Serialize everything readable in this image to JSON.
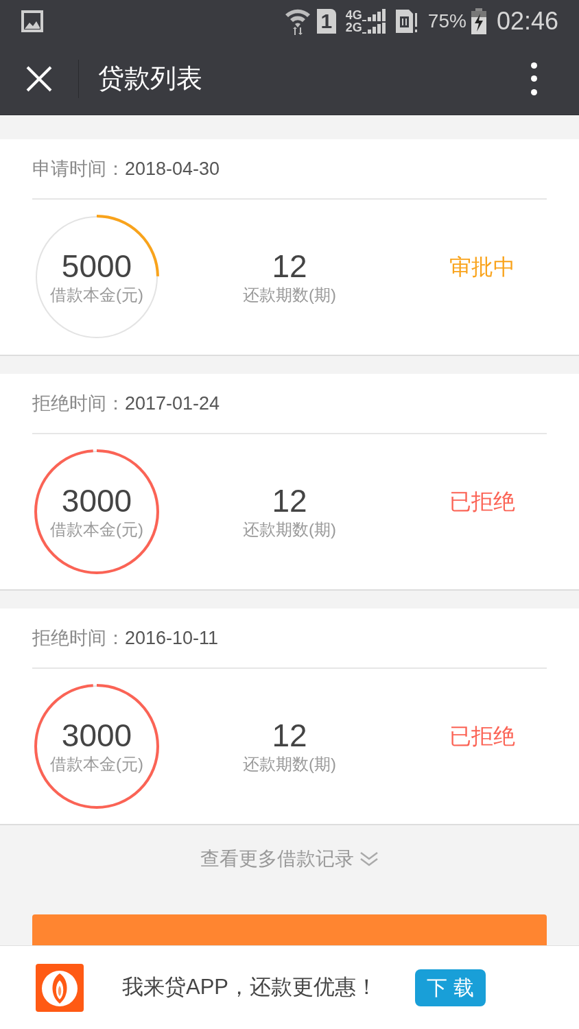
{
  "status_bar": {
    "sim_slot": "1",
    "network_labels": [
      "4G",
      "2G"
    ],
    "battery": "75%",
    "time": "02:46"
  },
  "nav_bar": {
    "title": "贷款列表"
  },
  "loans": [
    {
      "date_label": "申请时间：",
      "date": "2018-04-30",
      "amount": "5000",
      "amount_label": "借款本金(元)",
      "periods": "12",
      "periods_label": "还款期数(期)",
      "status": "审批中",
      "kind": "pending",
      "level": 0.25
    },
    {
      "date_label": "拒绝时间：",
      "date": "2017-01-24",
      "amount": "3000",
      "amount_label": "借款本金(元)",
      "periods": "12",
      "periods_label": "还款期数(期)",
      "status": "已拒绝",
      "kind": "rejected",
      "level": 1
    },
    {
      "date_label": "拒绝时间：",
      "date": "2016-10-11",
      "amount": "3000",
      "amount_label": "借款本金(元)",
      "periods": "12",
      "periods_label": "还款期数(期)",
      "status": "已拒绝",
      "kind": "rejected",
      "level": 1
    }
  ],
  "more_link": "查看更多借款记录",
  "banner": {
    "text": "我来贷APP，还款更优惠！",
    "button": "下 载"
  }
}
